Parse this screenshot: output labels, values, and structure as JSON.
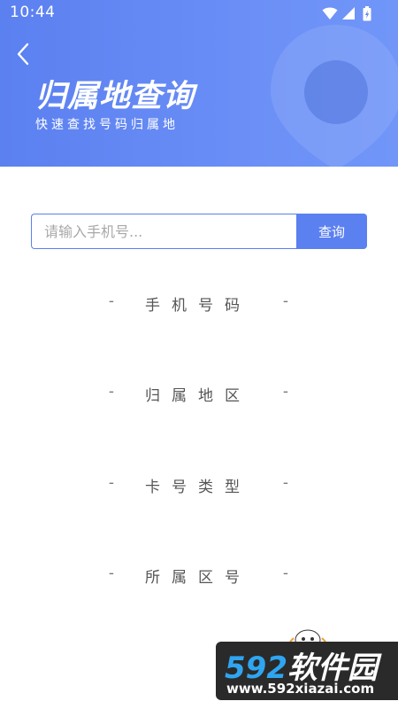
{
  "status_bar": {
    "time": "10:44"
  },
  "header": {
    "title": "归属地查询",
    "subtitle": "快速查找号码归属地",
    "gradient_start": "#5b80f0",
    "gradient_end": "#7196f8"
  },
  "search": {
    "placeholder": "请输入手机号...",
    "value": "",
    "button_label": "查询"
  },
  "results": [
    {
      "label": "手机号码",
      "dash": "-"
    },
    {
      "label": "归属地区",
      "dash": "-"
    },
    {
      "label": "卡号类型",
      "dash": "-"
    },
    {
      "label": "所属区号",
      "dash": "-"
    }
  ],
  "watermark": {
    "number": "592",
    "text": "软件园",
    "url": "www.592xiazai.com"
  },
  "colors": {
    "accent": "#5b80f0",
    "text": "#555555",
    "placeholder": "#a8a8a8"
  }
}
